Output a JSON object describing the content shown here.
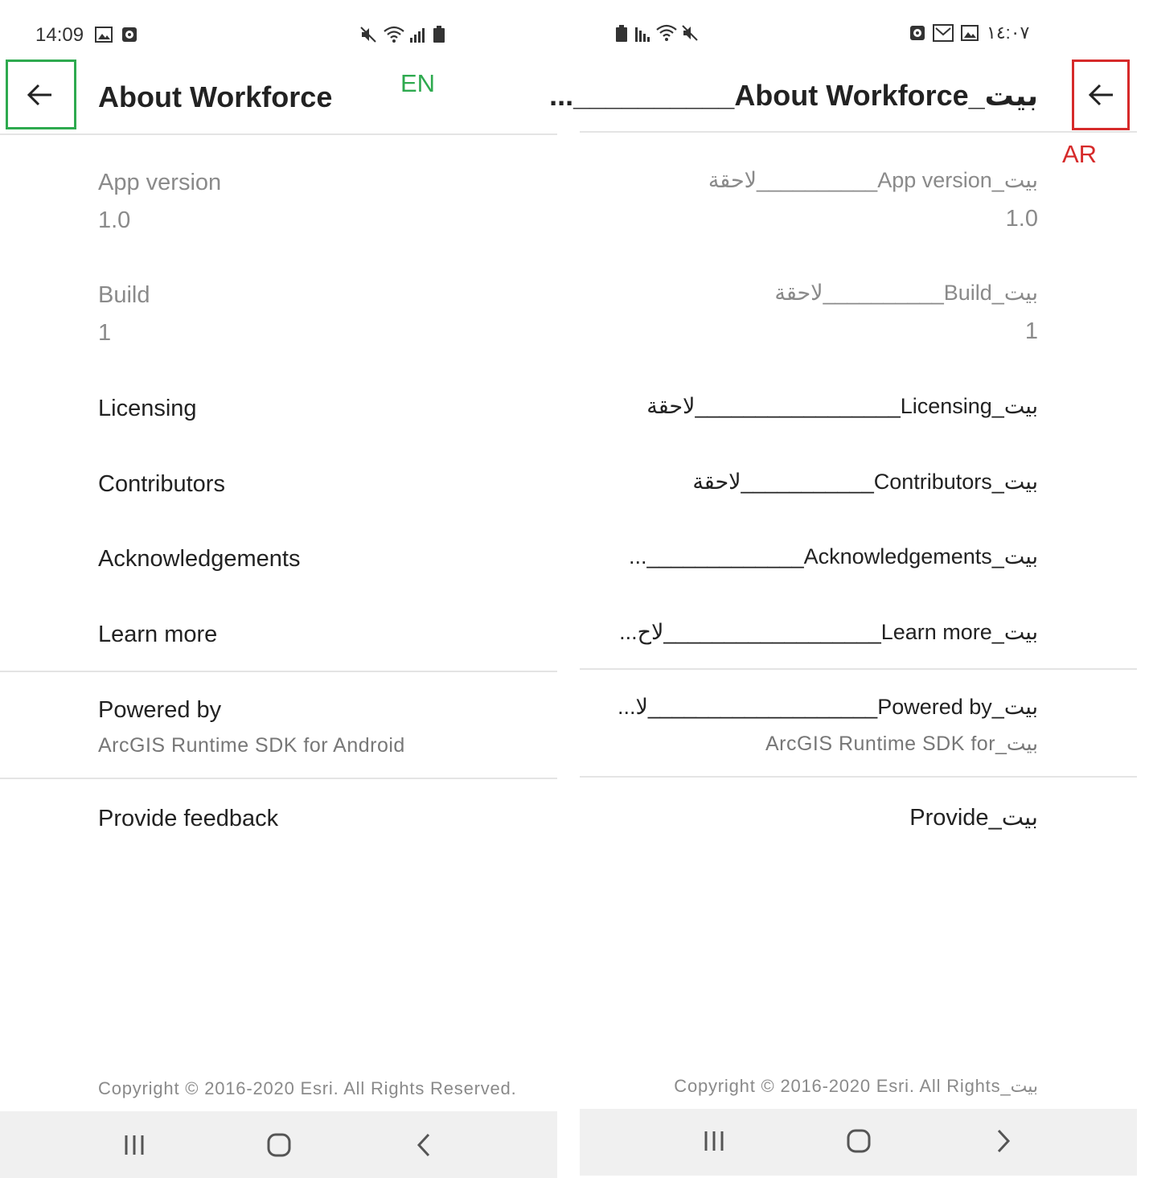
{
  "en": {
    "status": {
      "time": "14:09"
    },
    "language_tag": "EN",
    "header": {
      "title": "About Workforce"
    },
    "app_version": {
      "label": "App version",
      "value": "1.0"
    },
    "build": {
      "label": "Build",
      "value": "1"
    },
    "menu": {
      "licensing": "Licensing",
      "contributors": "Contributors",
      "acknowledgements": "Acknowledgements",
      "learn_more": "Learn more"
    },
    "powered_by": {
      "label": "Powered by",
      "value": "ArcGIS Runtime SDK for Android"
    },
    "feedback": "Provide feedback",
    "copyright": "Copyright © 2016-2020 Esri. All Rights Reserved."
  },
  "ar": {
    "status": {
      "time": "١٤:٠٧"
    },
    "language_tag": "AR",
    "header": {
      "title": "بيت_About Workforce__________..."
    },
    "app_version": {
      "label": "بيت_App version__________لاحقة",
      "value": "1.0"
    },
    "build": {
      "label": "بيت_Build__________لاحقة",
      "value": "1"
    },
    "menu": {
      "licensing": "بيت_Licensing_________________لاحقة",
      "contributors": "بيت_Contributors___________لاحقة",
      "acknowledgements": "بيت_Acknowledgements_____________...",
      "learn_more": "بيت_Learn more__________________لاح..."
    },
    "powered_by": {
      "label": "بيت_Powered by___________________لا...",
      "value": "بيت_ArcGIS Runtime SDK for"
    },
    "feedback": "بيت_Provide",
    "copyright": "بيت_Copyright © 2016-2020 Esri. All Rights"
  },
  "icons": {
    "back": "arrow-left-icon",
    "nav_recents": "recents-icon",
    "nav_home": "home-icon",
    "nav_back": "chevron-icon",
    "status": [
      "image-icon",
      "clock-icon",
      "mute-icon",
      "wifi-icon",
      "signal-icon",
      "battery-icon",
      "mail-icon"
    ]
  },
  "colors": {
    "en_highlight": "#2eaa4f",
    "ar_highlight": "#d62a2a",
    "navbar": "#f0f0f0",
    "muted_text": "#8a8a8a"
  }
}
